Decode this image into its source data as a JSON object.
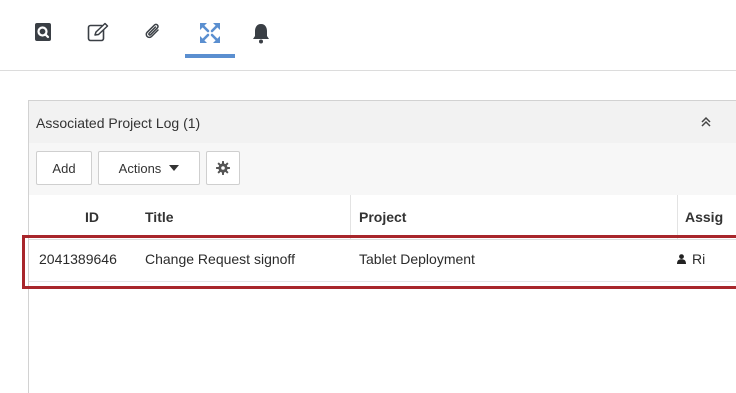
{
  "tabs": [
    {
      "icon": "search-doc-icon"
    },
    {
      "icon": "edit-icon"
    },
    {
      "icon": "paperclip-icon"
    },
    {
      "icon": "expand-arrows-icon",
      "active": true
    },
    {
      "icon": "bell-icon"
    }
  ],
  "panel": {
    "title": "Associated Project Log (1)",
    "toolbar": {
      "add_label": "Add",
      "actions_label": "Actions"
    },
    "columns": [
      "ID",
      "Title",
      "Project",
      "Assig"
    ],
    "rows": [
      {
        "id": "2041389646",
        "title": "Change Request signoff",
        "project": "Tablet Deployment",
        "assignee": "Ri"
      }
    ]
  },
  "colors": {
    "active_tab": "#5b8fd0",
    "highlight": "#a8262b",
    "header_bg": "#f2f2f2"
  }
}
